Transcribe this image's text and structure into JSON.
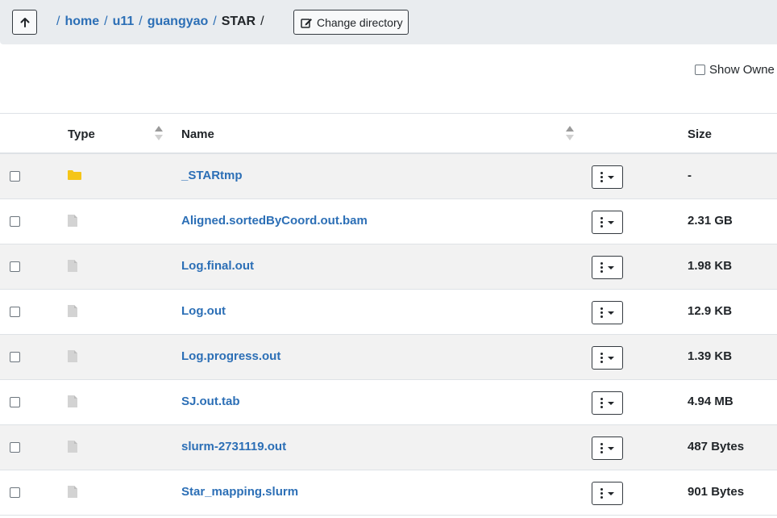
{
  "header": {
    "breadcrumb": [
      {
        "label": "home",
        "link": true
      },
      {
        "label": "u11",
        "link": true
      },
      {
        "label": "guangyao",
        "link": true
      },
      {
        "label": "STAR",
        "link": false
      }
    ],
    "change_dir_label": "Change directory",
    "up_icon": "arrow-up-icon",
    "edit_icon": "edit-icon"
  },
  "options": {
    "show_owner_label": "Show Owne"
  },
  "table": {
    "columns": {
      "type": "Type",
      "name": "Name",
      "size": "Size"
    },
    "rows": [
      {
        "type": "folder",
        "name": "_STARtmp",
        "size": "-"
      },
      {
        "type": "file",
        "name": "Aligned.sortedByCoord.out.bam",
        "size": "2.31 GB"
      },
      {
        "type": "file",
        "name": "Log.final.out",
        "size": "1.98 KB"
      },
      {
        "type": "file",
        "name": "Log.out",
        "size": "12.9 KB"
      },
      {
        "type": "file",
        "name": "Log.progress.out",
        "size": "1.39 KB"
      },
      {
        "type": "file",
        "name": "SJ.out.tab",
        "size": "4.94 MB"
      },
      {
        "type": "file",
        "name": "slurm-2731119.out",
        "size": "487 Bytes"
      },
      {
        "type": "file",
        "name": "Star_mapping.slurm",
        "size": "901 Bytes"
      }
    ]
  },
  "colors": {
    "link": "#2c6fb6",
    "folder": "#f5c518",
    "file_icon": "#d3d3d3",
    "header_bg": "#e9ecef",
    "stripe": "#f2f2f2"
  }
}
